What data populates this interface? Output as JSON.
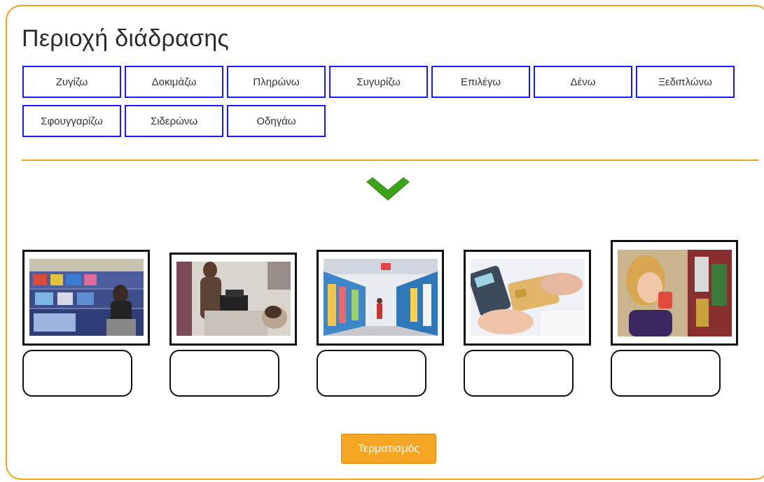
{
  "header": {
    "title": "Περιοχή διάδρασης"
  },
  "chips": [
    "Ζυγίζω",
    "Δοκιμάζω",
    "Πληρώνω",
    "Συγυρίζω",
    "Επιλέγω",
    "Δένω",
    "Ξεδιπλώνω",
    "Σφουγγαρίζω",
    "Σιδερώνω",
    "Οδηγάω"
  ],
  "images": [
    "store-shelves-shopper-photo",
    "cashier-register-photo",
    "supermarket-aisle-photo",
    "card-payment-terminal-photo",
    "woman-tasting-drink-photo"
  ],
  "footer": {
    "finish_label": "Τερματισμός"
  },
  "colors": {
    "accent": "#f2a31b",
    "chip_border": "#1a1aff",
    "button": "#f5a623",
    "check": "#3aa419"
  }
}
